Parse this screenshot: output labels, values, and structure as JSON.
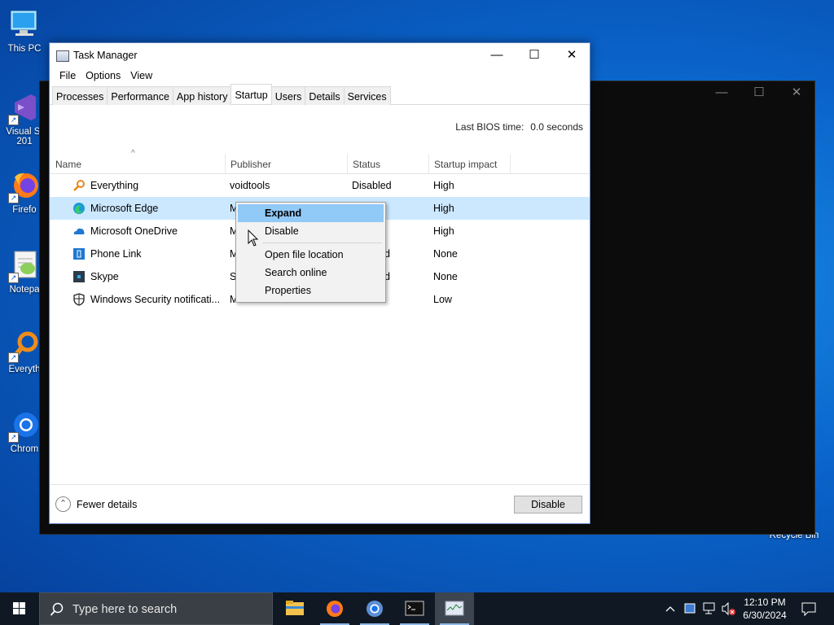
{
  "desktop": {
    "icons": [
      {
        "label": "This PC",
        "icon": "computer-icon"
      },
      {
        "label": "Visual St 201",
        "icon": "visual-studio-icon"
      },
      {
        "label": "Firefo",
        "icon": "firefox-icon"
      },
      {
        "label": "Notepa",
        "icon": "notepad-plus-icon"
      },
      {
        "label": "Everyth",
        "icon": "everything-icon"
      },
      {
        "label": "Chrom",
        "icon": "chrome-icon"
      }
    ],
    "recycle_bin": "Recycle Bin"
  },
  "task_manager": {
    "title": "Task Manager",
    "menu": [
      "File",
      "Options",
      "View"
    ],
    "tabs": [
      "Processes",
      "Performance",
      "App history",
      "Startup",
      "Users",
      "Details",
      "Services"
    ],
    "active_tab": "Startup",
    "last_bios_label": "Last BIOS time:",
    "last_bios_value": "0.0 seconds",
    "columns": [
      "Name",
      "Publisher",
      "Status",
      "Startup impact"
    ],
    "rows": [
      {
        "name": "Everything",
        "publisher": "voidtools",
        "status": "Disabled",
        "impact": "High",
        "icon": "everything-icon"
      },
      {
        "name": "Microsoft Edge",
        "publisher": "M",
        "status": "",
        "impact": "High",
        "icon": "edge-icon",
        "selected": true
      },
      {
        "name": "Microsoft OneDrive",
        "publisher": "M",
        "status": "",
        "impact": "High",
        "icon": "onedrive-icon"
      },
      {
        "name": "Phone Link",
        "publisher": "M",
        "status": "d",
        "impact": "None",
        "icon": "phone-link-icon"
      },
      {
        "name": "Skype",
        "publisher": "S",
        "status": "d",
        "impact": "None",
        "icon": "skype-icon"
      },
      {
        "name": "Windows Security notificati...",
        "publisher": "M",
        "status": "",
        "impact": "Low",
        "icon": "shield-icon"
      }
    ],
    "fewer_details": "Fewer details",
    "disable_button": "Disable"
  },
  "context_menu": {
    "items": [
      "Expand",
      "Disable",
      "Open file location",
      "Search online",
      "Properties"
    ],
    "highlighted": "Expand"
  },
  "taskbar": {
    "search_placeholder": "Type here to search",
    "apps": [
      "file-explorer-icon",
      "firefox-icon",
      "chrome-icon",
      "terminal-icon",
      "task-manager-icon"
    ],
    "time": "12:10 PM",
    "date": "6/30/2024"
  },
  "colors": {
    "accent_selection": "#cce8ff",
    "menu_highlight": "#91c9f7",
    "taskbar": "#101923"
  }
}
